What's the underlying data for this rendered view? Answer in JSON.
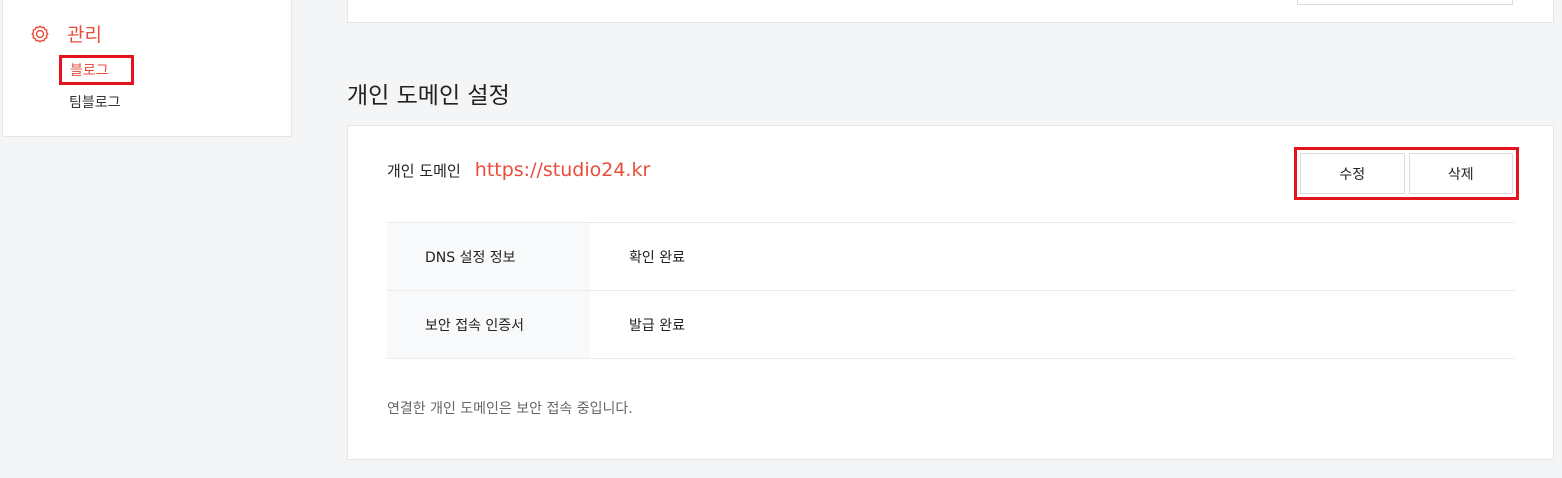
{
  "sidebar": {
    "title": "관리",
    "icon": "gear-icon",
    "items": [
      {
        "label": "블로그",
        "active": true
      },
      {
        "label": "팀블로그",
        "active": false
      }
    ]
  },
  "section": {
    "title": "개인 도메인 설정"
  },
  "domain": {
    "label": "개인 도메인",
    "url": "https://studio24.kr"
  },
  "actions": {
    "edit_label": "수정",
    "delete_label": "삭제"
  },
  "info_rows": [
    {
      "label": "DNS 설정 정보",
      "value": "확인 완료"
    },
    {
      "label": "보안 접속 인증서",
      "value": "발급 완료"
    }
  ],
  "note": "연결한 개인 도메인은 보안 접속 중입니다.",
  "colors": {
    "accent": "#e84d3b",
    "highlight_box": "#e3141d",
    "background": "#f4f5f7"
  }
}
